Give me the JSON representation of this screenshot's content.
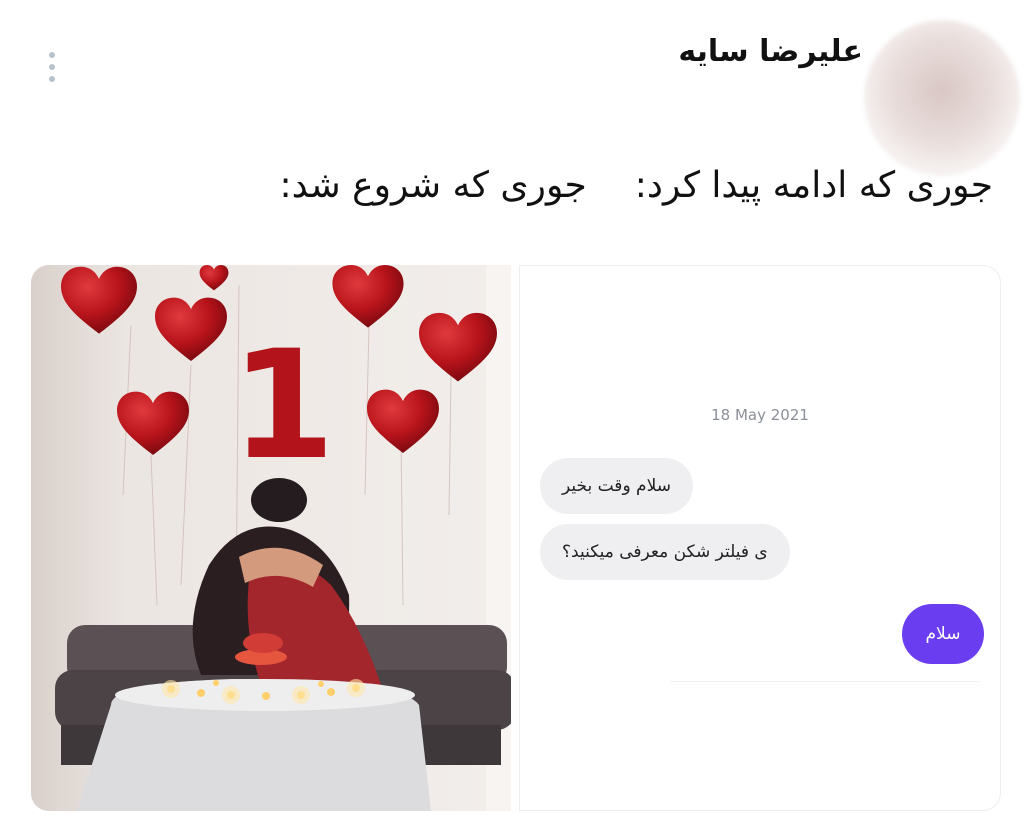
{
  "tweet": {
    "author_name": "علیرضا سایه",
    "text_part_1": "جوری که شروع شد:",
    "text_part_2": "جوری که ادامه پیدا کرد:"
  },
  "icons": {
    "more": "more-vertical-icon"
  },
  "chat_screenshot": {
    "date": "18 May 2021",
    "messages": [
      {
        "direction": "incoming",
        "text": "سلام وقت بخیر"
      },
      {
        "direction": "incoming",
        "text": "ی فیلتر شکن معرفی میکنید؟"
      },
      {
        "direction": "outgoing",
        "text": "سلام"
      }
    ]
  },
  "photo": {
    "balloon_number": "1"
  },
  "colors": {
    "outgoing_bubble": "#6a3df0",
    "incoming_bubble": "#efeff1",
    "balloon": "#c0161d"
  }
}
